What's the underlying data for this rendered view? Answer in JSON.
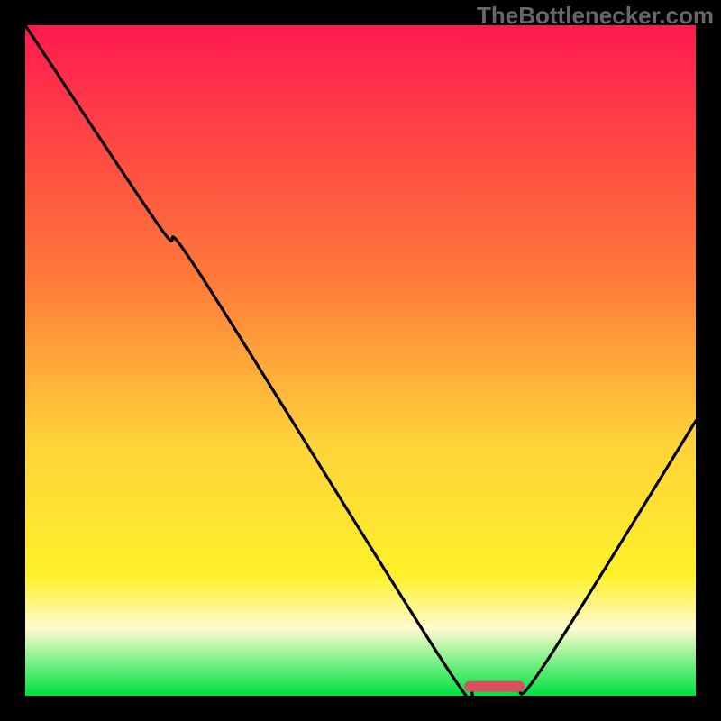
{
  "watermark": "TheBottlenecker.com",
  "chart_data": {
    "type": "line",
    "title": "",
    "xlabel": "",
    "ylabel": "",
    "xlim": [
      0,
      100
    ],
    "ylim": [
      0,
      100
    ],
    "gradient": {
      "top": "#ff1a4e",
      "mid_upper": "#ff7a3a",
      "mid": "#ffd23a",
      "mid_lower": "#fff02a",
      "ivory": "#fffad0",
      "green_light": "#7aef86",
      "green": "#00e040"
    },
    "curve": [
      {
        "x": 0.0,
        "y": 100.0
      },
      {
        "x": 20.0,
        "y": 70.0
      },
      {
        "x": 26.0,
        "y": 63.0
      },
      {
        "x": 63.0,
        "y": 4.0
      },
      {
        "x": 67.0,
        "y": 1.2
      },
      {
        "x": 73.0,
        "y": 1.2
      },
      {
        "x": 77.0,
        "y": 4.0
      },
      {
        "x": 100.0,
        "y": 41.0
      }
    ],
    "marker": {
      "x_start": 65.5,
      "x_end": 74.5,
      "y": 1.4,
      "color": "#d94f5e"
    }
  }
}
